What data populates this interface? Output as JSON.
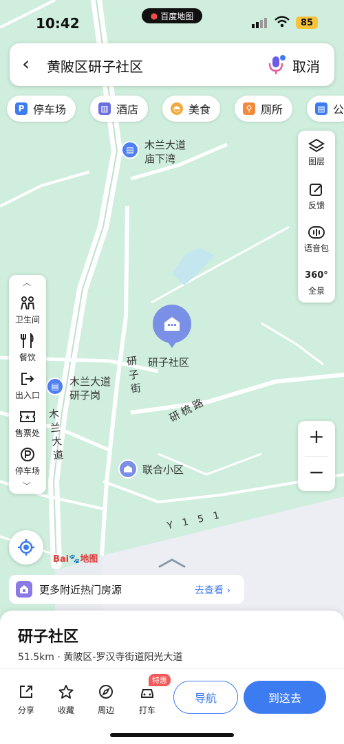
{
  "status_bar": {
    "time": "10:42",
    "app_badge": "百度地图",
    "battery": "85"
  },
  "search": {
    "query": "黄陂区研子社区",
    "cancel_label": "取消"
  },
  "categories": [
    {
      "label": "停车场",
      "icon": "parking-icon",
      "color": "#3d7bf0"
    },
    {
      "label": "酒店",
      "icon": "hotel-icon",
      "color": "#6b6fe0"
    },
    {
      "label": "美食",
      "icon": "food-icon",
      "color": "#f2a93b"
    },
    {
      "label": "厕所",
      "icon": "toilet-icon",
      "color": "#f28a3b"
    },
    {
      "label": "公",
      "icon": "bus-icon",
      "color": "#3d7bf0"
    }
  ],
  "right_tools": {
    "layers": "图层",
    "feedback": "反馈",
    "voice_pack": "语音包",
    "panorama_badge": "360°",
    "panorama": "全景"
  },
  "left_tools": {
    "restroom": "卫生间",
    "dining": "餐饮",
    "exit": "出入口",
    "ticket": "售票处",
    "parking": "停车场"
  },
  "map_labels": {
    "stop1_line1": "木兰大道",
    "stop1_line2": "庙下湾",
    "target": "研子社区",
    "street1": "研子街",
    "stop2_line1": "木兰大道",
    "stop2_line2": "研子岗",
    "road_yanliu": "研梳路",
    "road_mulan": "木兰大道",
    "poi_lianhe": "联合小区",
    "road_y151": "Y151",
    "logo": "Bai地图"
  },
  "zoom": {
    "in": "+",
    "out": "−"
  },
  "banner": {
    "text": "更多附近热门房源",
    "link": "去查看 ›"
  },
  "place": {
    "name": "研子社区",
    "info": "51.5km · 黄陂区-罗汉寺街道阳光大道"
  },
  "actions": {
    "share": "分享",
    "favorite": "收藏",
    "nearby": "周边",
    "taxi": "打车",
    "taxi_badge": "特惠"
  },
  "buttons": {
    "navigate": "导航",
    "go_here": "到这去"
  },
  "colors": {
    "map_bg": "#cfeedd",
    "road": "#ffffff",
    "accent": "#3d7bf0",
    "land_grey": "#e9ecf2"
  }
}
